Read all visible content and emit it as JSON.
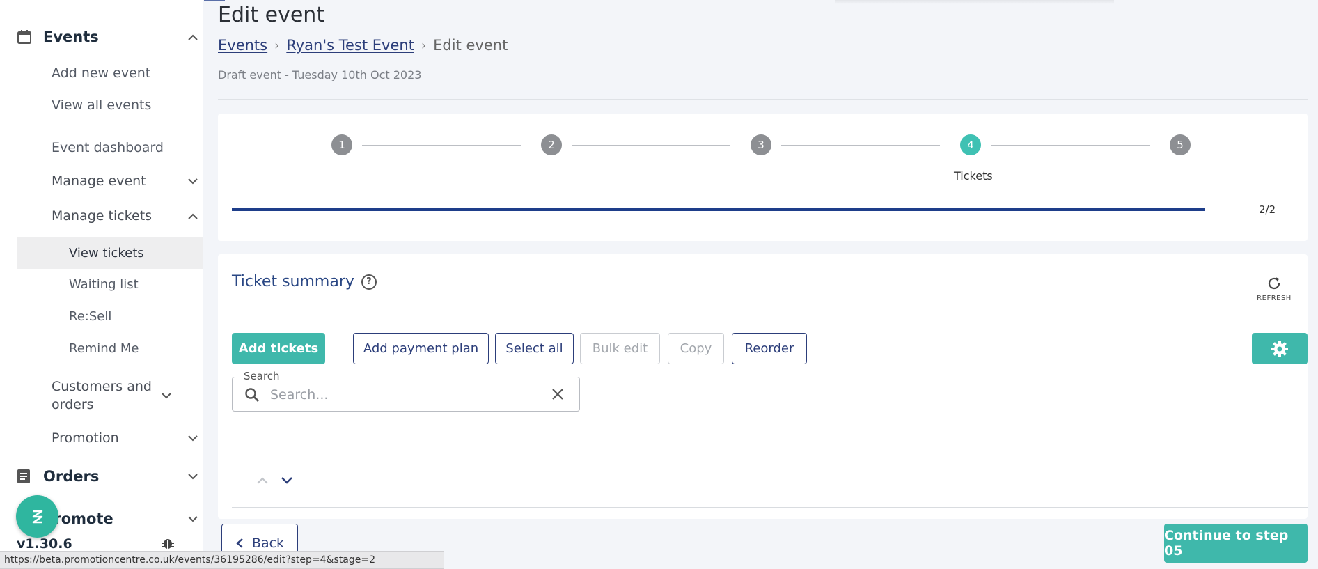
{
  "sidebar": {
    "events": {
      "label": "Events",
      "icon": "calendar-icon"
    },
    "events_items": [
      "Add new event",
      "View all events"
    ],
    "event_dashboard": "Event dashboard",
    "manage_event": "Manage event",
    "manage_tickets": "Manage tickets",
    "ticket_items": [
      "View tickets",
      "Waiting list",
      "Re:Sell",
      "Remind Me"
    ],
    "customers_orders": "Customers and orders",
    "promotion": "Promotion",
    "orders": {
      "label": "Orders",
      "icon": "document-icon"
    },
    "promote": "Promote",
    "version": "v1.30.6"
  },
  "header": {
    "title": "Edit event",
    "breadcrumb": [
      "Events",
      "Ryan's Test Event",
      "Edit event"
    ],
    "subtitle": "Draft event - Tuesday 10th Oct 2023"
  },
  "stepper": {
    "steps": [
      "1",
      "2",
      "3",
      "4",
      "5"
    ],
    "active_step": 4,
    "active_label": "Tickets",
    "progress_text": "2/2",
    "progress_fraction": 1.0
  },
  "ticket_summary": {
    "title": "Ticket summary",
    "refresh_label": "REFRESH",
    "buttons": {
      "add_tickets": "Add tickets",
      "add_payment_plan": "Add payment plan",
      "select_all": "Select all",
      "bulk_edit": "Bulk edit",
      "copy": "Copy",
      "reorder": "Reorder"
    },
    "search": {
      "legend": "Search",
      "placeholder": "Search..."
    }
  },
  "footer": {
    "back": "Back",
    "continue": "Continue to step 05"
  },
  "status_url": "https://beta.promotioncentre.co.uk/events/36195286/edit?step=4&stage=2",
  "colors": {
    "accent": "#3fb8ab",
    "primary": "#2c3e7a",
    "progress": "#1e3e8a"
  }
}
